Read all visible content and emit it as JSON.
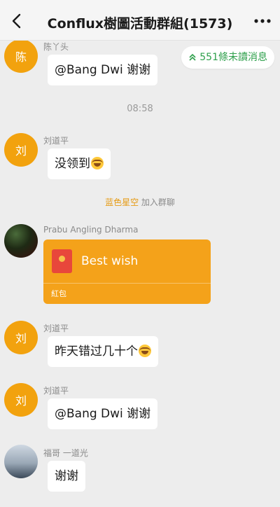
{
  "header": {
    "title": "Conflux樹圖活動群組(1573)"
  },
  "unread_banner": {
    "text": "551條未讀消息",
    "color": "#2fa04c"
  },
  "messages": [
    {
      "sender": "陈丫头",
      "avatar_text": "陈",
      "text": "@Bang Dwi 谢谢"
    },
    {
      "time": "08:58"
    },
    {
      "sender": "刘道平",
      "avatar_text": "刘",
      "text": "没领到",
      "emoji": "tears-of-joy"
    },
    {
      "system": {
        "name": "蓝色星空",
        "action": "加入群聊"
      }
    },
    {
      "sender": "Prabu Angling Dharma",
      "red_packet": {
        "title": "Best wish",
        "label": "紅包"
      }
    },
    {
      "sender": "刘道平",
      "avatar_text": "刘",
      "text": "昨天错过几十个",
      "emoji": "tears-of-joy"
    },
    {
      "sender": "刘道平",
      "avatar_text": "刘",
      "text": "@Bang Dwi 谢谢"
    },
    {
      "sender": "福哥 一道光",
      "text": "谢谢"
    }
  ],
  "colors": {
    "background": "#ededed",
    "avatar_orange": "#f2a20e",
    "red_packet": "#f4a21a",
    "system_highlight": "#e69b14"
  }
}
